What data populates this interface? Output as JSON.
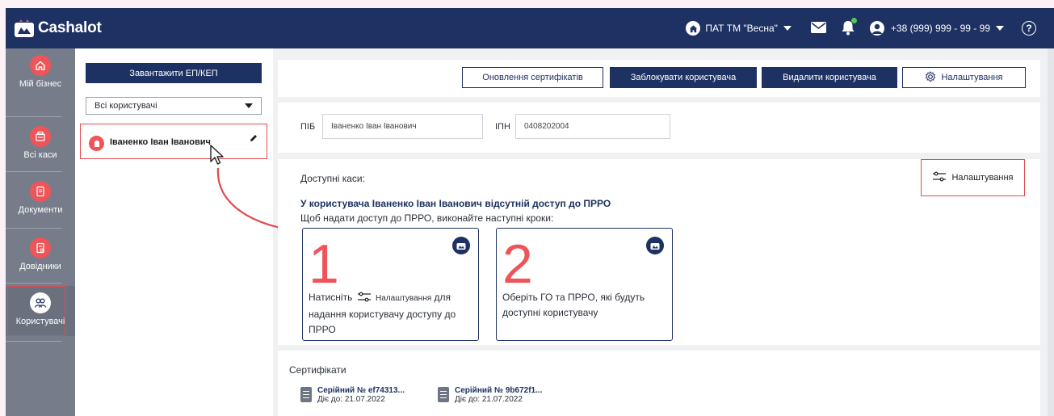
{
  "brand": {
    "name": "Cashalot"
  },
  "header": {
    "company": "ПАТ ТМ \"Весна\"",
    "phone": "+38 (999) 999 - 99 - 99",
    "help_glyph": "?",
    "icons": [
      "home-icon",
      "mail-icon",
      "bell-icon",
      "user-icon",
      "help-icon"
    ]
  },
  "sidebar": {
    "items": [
      {
        "label": "Мій бізнес",
        "icon": "home-icon"
      },
      {
        "label": "Всі каси",
        "icon": "cash-register-icon"
      },
      {
        "label": "Документи",
        "icon": "document-icon"
      },
      {
        "label": "Довідники",
        "icon": "reference-icon"
      },
      {
        "label": "Користувачі",
        "icon": "users-icon"
      }
    ]
  },
  "users_panel": {
    "upload_button": "Завантажити ЕП/КЕП",
    "filter_value": "Всі користувачі",
    "users": [
      {
        "name": "Іваненко Іван Іванович"
      }
    ]
  },
  "toolbar": {
    "update_certs": "Оновлення сертифікатів",
    "block_user": "Заблокувати користувача",
    "delete_user": "Видалити користувача",
    "settings": "Налаштування"
  },
  "user_form": {
    "name_label": "ПІБ",
    "name_value": "Іваненко Іван Іванович",
    "tax_label": "ІПН",
    "tax_value": "0408202004"
  },
  "access": {
    "title": "Доступні каси:",
    "settings_label": "Налаштування",
    "no_access_heading": "У користувача Іваненко Іван Іванович відсутній доступ до ПРРО",
    "instructions": "Щоб надати доступ до ПРРО, виконайте наступні кроки:",
    "steps": [
      {
        "number": "1",
        "text_before": "Натисніть",
        "link_label": "Налаштування",
        "text_after_1": "для",
        "text_after_2": "надання користувачу доступу до",
        "text_after_3": "ПРРО"
      },
      {
        "number": "2",
        "line1": "Оберіть ГО та ПРРО, які будуть",
        "line2": "доступні користувачу"
      }
    ]
  },
  "certificates": {
    "title": "Сертифікати",
    "items": [
      {
        "serial": "Серійний № ef74313...",
        "valid": "Діє до: 21.07.2022"
      },
      {
        "serial": "Серійний № 9b672f1...",
        "valid": "Діє до: 21.07.2022"
      }
    ]
  },
  "colors": {
    "navy": "#1e3163",
    "accent": "#ef5459",
    "sidebar": "#767c8a",
    "highlight": "#e24a4f"
  }
}
